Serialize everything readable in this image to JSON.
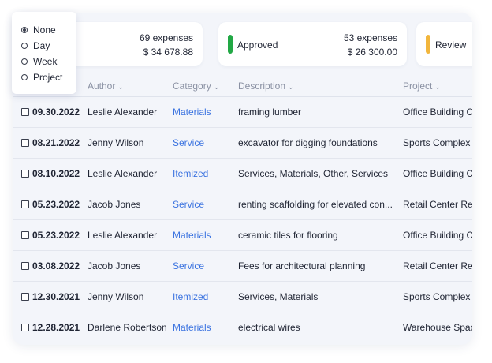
{
  "cards": [
    {
      "count": "69 expenses",
      "amount": "$ 34 678.88"
    },
    {
      "label": "Approved",
      "count": "53 expenses",
      "amount": "$ 26 300.00",
      "color": "#22a845"
    },
    {
      "label": "Review",
      "color": "#f2b63d"
    }
  ],
  "filter": {
    "options": [
      "None",
      "Day",
      "Week",
      "Project"
    ],
    "selected": "None"
  },
  "table": {
    "headers": {
      "author": "Author",
      "category": "Category",
      "description": "Description",
      "project": "Project"
    },
    "rows": [
      {
        "date": "09.30.2022",
        "author": "Leslie Alexander",
        "category": "Materials",
        "description": "framing lumber",
        "project": "Office Building C"
      },
      {
        "date": "08.21.2022",
        "author": "Jenny Wilson",
        "category": "Service",
        "description": "excavator for digging foundations",
        "project": "Sports Complex"
      },
      {
        "date": "08.10.2022",
        "author": "Leslie Alexander",
        "category": "Itemized",
        "description": "Services, Materials, Other, Services",
        "project": "Office Building C"
      },
      {
        "date": "05.23.2022",
        "author": "Jacob Jones",
        "category": "Service",
        "description": "renting scaffolding for elevated con...",
        "project": "Retail Center Ren"
      },
      {
        "date": "05.23.2022",
        "author": "Leslie Alexander",
        "category": "Materials",
        "description": "ceramic tiles for flooring",
        "project": "Office Building C"
      },
      {
        "date": "03.08.2022",
        "author": "Jacob Jones",
        "category": "Service",
        "description": "Fees for architectural planning",
        "project": "Retail Center Ren"
      },
      {
        "date": "12.30.2021",
        "author": "Jenny Wilson",
        "category": "Itemized",
        "description": "Services, Materials",
        "project": "Sports Complex"
      },
      {
        "date": "12.28.2021",
        "author": "Darlene Robertson",
        "category": "Materials",
        "description": "electrical wires",
        "project": "Warehouse Spac"
      }
    ]
  }
}
